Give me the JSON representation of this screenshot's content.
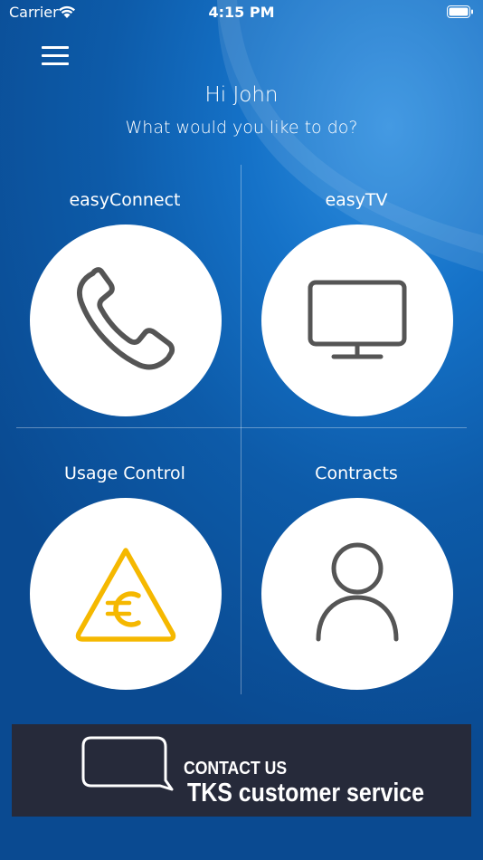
{
  "status_bar": {
    "carrier": "Carrier",
    "time": "4:15 PM",
    "wifi_icon": "wifi-icon",
    "battery_icon": "battery-icon"
  },
  "header": {
    "menu_icon": "hamburger-menu-icon",
    "greeting": "Hi John",
    "subtitle": "What would you like to do?"
  },
  "tiles": [
    {
      "label": "easyConnect",
      "icon": "phone-icon"
    },
    {
      "label": "easyTV",
      "icon": "tv-icon"
    },
    {
      "label": "Usage Control",
      "icon": "euro-warning-icon",
      "icon_color": "#f5b800"
    },
    {
      "label": "Contracts",
      "icon": "person-icon"
    }
  ],
  "contact": {
    "line1": "CONTACT US",
    "line2": "TKS customer service",
    "icon": "chat-bubble-icon",
    "background": "#262a3a"
  },
  "colors": {
    "background": "#0d5ba9",
    "icon_gray": "#555555",
    "accent_yellow": "#f5b800"
  }
}
